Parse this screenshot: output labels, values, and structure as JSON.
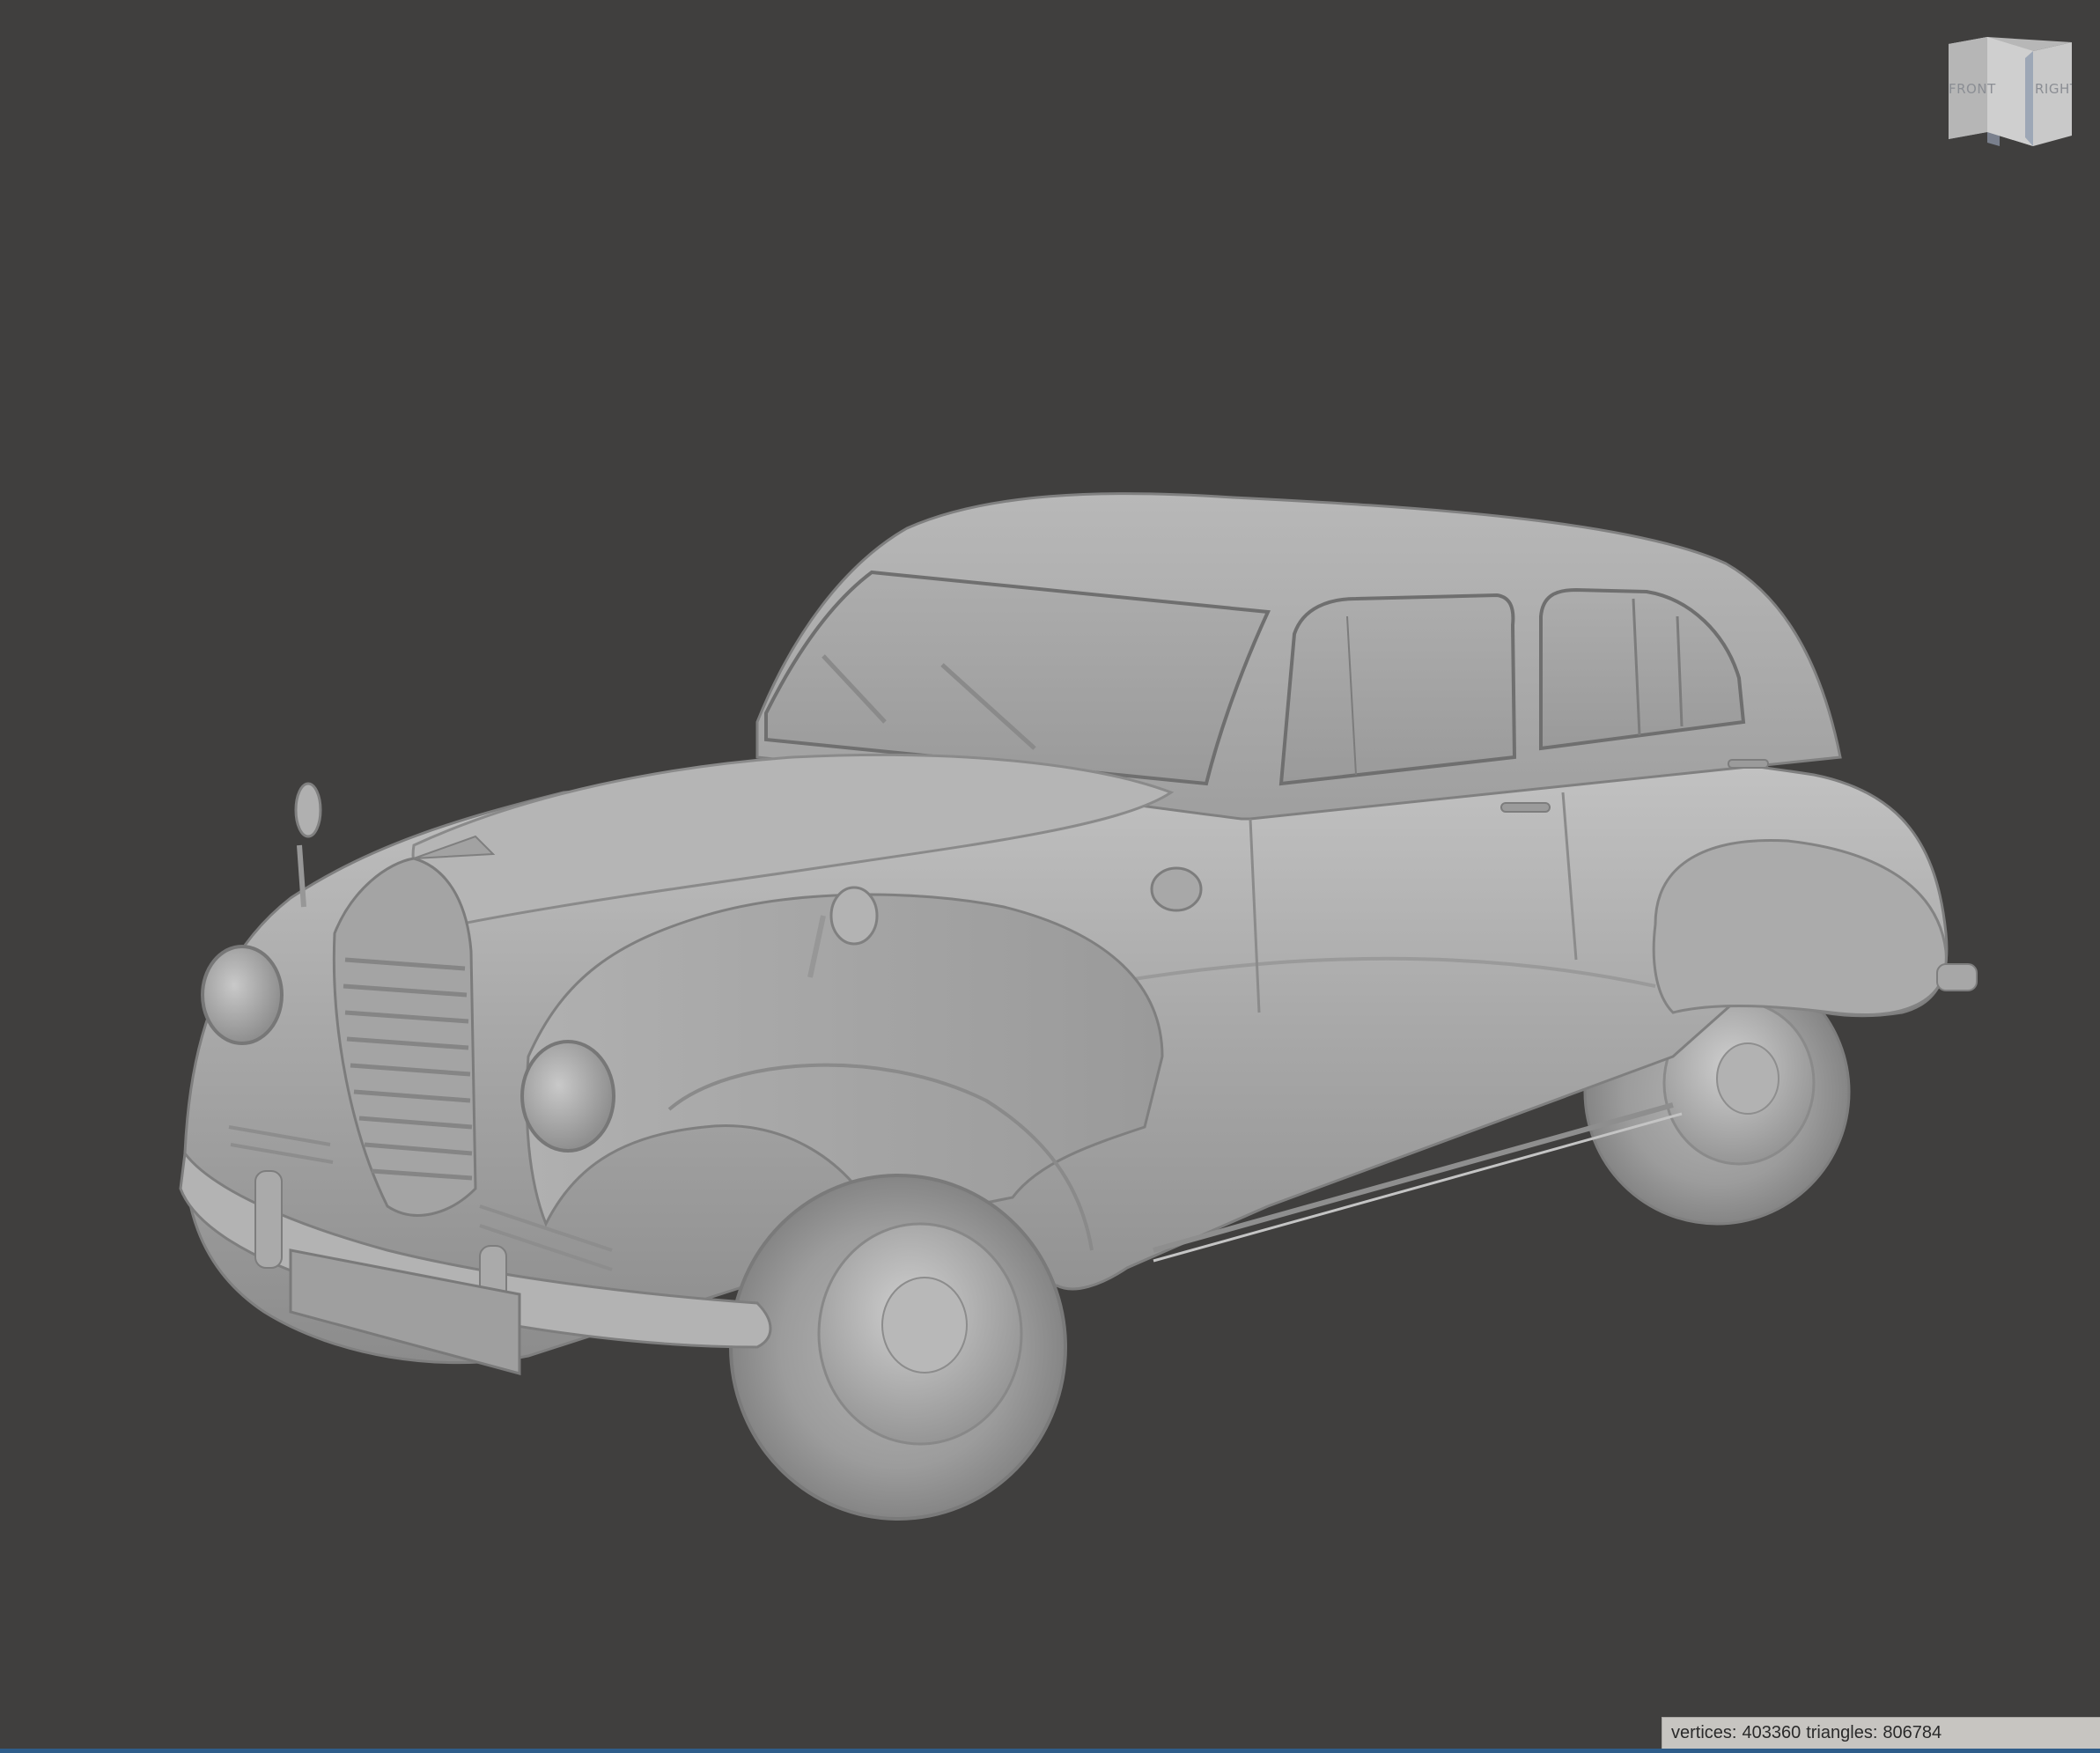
{
  "viewport": {
    "background_color": "#403f3e",
    "model_color": "#a6a6a6"
  },
  "view_cube": {
    "front_label": "FRONT",
    "right_label": "RIGHT"
  },
  "status_bar": {
    "vertices_label": "vertices:",
    "vertices_value": "403360",
    "triangles_label": "triangles:",
    "triangles_value": "806784"
  },
  "icons": {
    "view_cube": "cube-orientation-icon"
  }
}
